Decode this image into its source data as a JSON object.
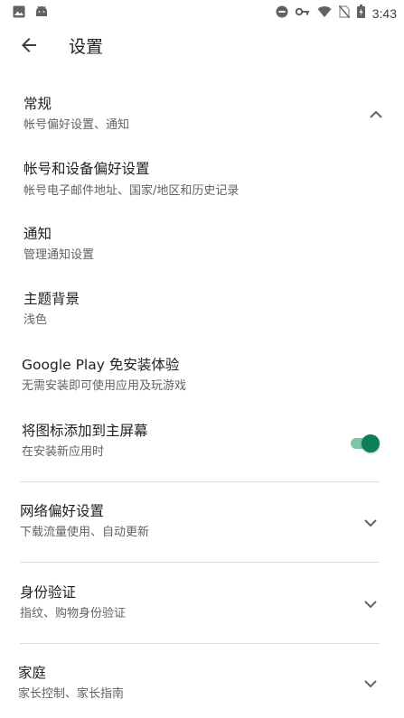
{
  "status_bar": {
    "time": "3:43",
    "icons": [
      "image-icon",
      "android-icon",
      "dnd-icon",
      "key-icon",
      "wifi-icon",
      "no-sim-icon",
      "battery-icon"
    ]
  },
  "header": {
    "title": "设置"
  },
  "sections": {
    "general": {
      "title": "常规",
      "subtitle": "帐号偏好设置、通知",
      "expanded": true
    },
    "items": [
      {
        "title": "帐号和设备偏好设置",
        "subtitle": "帐号电子邮件地址、国家/地区和历史记录"
      },
      {
        "title": "通知",
        "subtitle": "管理通知设置"
      },
      {
        "title": "主题背景",
        "subtitle": "浅色"
      },
      {
        "title": "Google Play 免安装体验",
        "subtitle": "无需安装即可使用应用及玩游戏"
      },
      {
        "title": "将图标添加到主屏幕",
        "subtitle": "在安装新应用时",
        "toggle_on": true
      }
    ],
    "network": {
      "title": "网络偏好设置",
      "subtitle": "下载流量使用、自动更新"
    },
    "auth": {
      "title": "身份验证",
      "subtitle": "指纹、购物身份验证"
    },
    "family": {
      "title": "家庭",
      "subtitle": "家长控制、家长指南"
    }
  },
  "colors": {
    "accent": "#0b7f55",
    "accent_track": "#7fc4a6",
    "divider": "#dadce0",
    "subtitle": "#5f6368"
  }
}
